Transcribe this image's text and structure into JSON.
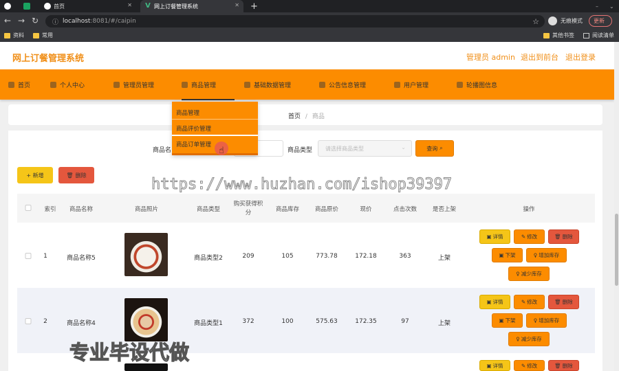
{
  "browser": {
    "tabs": [
      {
        "label": "",
        "icon": "globe-icon"
      },
      {
        "label": "",
        "icon": "sheet-icon"
      },
      {
        "label": "首页",
        "icon": "globe-icon"
      },
      {
        "label": "网上订餐管理系统",
        "icon": "vue-icon"
      }
    ],
    "new_tab": "+",
    "url_host": "localhost",
    "url_rest": ":8081/#/caipin",
    "incognito_label": "无痕模式",
    "update_label": "更新",
    "bookmarks": [
      "资料",
      "常用"
    ],
    "bookmarks_right": [
      "其他书签",
      "阅读清单"
    ]
  },
  "header": {
    "title": "网上订餐管理系统",
    "admin": "管理员 admin",
    "back_front": "退出到前台",
    "logout": "退出登录"
  },
  "menu": [
    {
      "label": "首页",
      "icon": "home-icon"
    },
    {
      "label": "个人中心",
      "icon": "user-icon"
    },
    {
      "label": "管理员管理",
      "icon": "admin-icon"
    },
    {
      "label": "商品管理",
      "icon": "goods-icon"
    },
    {
      "label": "基础数据管理",
      "icon": "data-icon"
    },
    {
      "label": "公告信息管理",
      "icon": "notice-icon"
    },
    {
      "label": "用户管理",
      "icon": "users-icon"
    },
    {
      "label": "轮播图信息",
      "icon": "carousel-icon"
    }
  ],
  "dropdown": [
    "商品管理",
    "商品评价管理",
    "商品订单管理"
  ],
  "breadcrumb": {
    "home": "首页",
    "sep": "/",
    "current": "商品"
  },
  "search": {
    "name_label": "商品名",
    "type_label": "商品类型",
    "type_placeholder": "请选择商品类型",
    "query_btn": "查询"
  },
  "actions": {
    "add": "+ 新增",
    "delete": "删除"
  },
  "watermark": "https://www.huzhan.com/ishop39397",
  "table": {
    "headers": [
      "索引",
      "商品名称",
      "商品照片",
      "商品类型",
      "购买获得积分",
      "商品库存",
      "商品原价",
      "现价",
      "点击次数",
      "是否上架",
      "操作"
    ],
    "rows": [
      {
        "index": "1",
        "name": "商品名称5",
        "type": "商品类型2",
        "points": "209",
        "stock": "105",
        "orig": "773.78",
        "price": "172.18",
        "clicks": "363",
        "onsale": "上架"
      },
      {
        "index": "2",
        "name": "商品名称4",
        "type": "商品类型1",
        "points": "372",
        "stock": "100",
        "orig": "575.63",
        "price": "172.35",
        "clicks": "97",
        "onsale": "上架"
      }
    ],
    "ops": {
      "detail": "详情",
      "edit": "修改",
      "delete": "删除",
      "off": "下架",
      "add_stock": "增加库存",
      "reduce_stock": "减少库存"
    }
  },
  "bottom_watermark": "专业毕设代做"
}
